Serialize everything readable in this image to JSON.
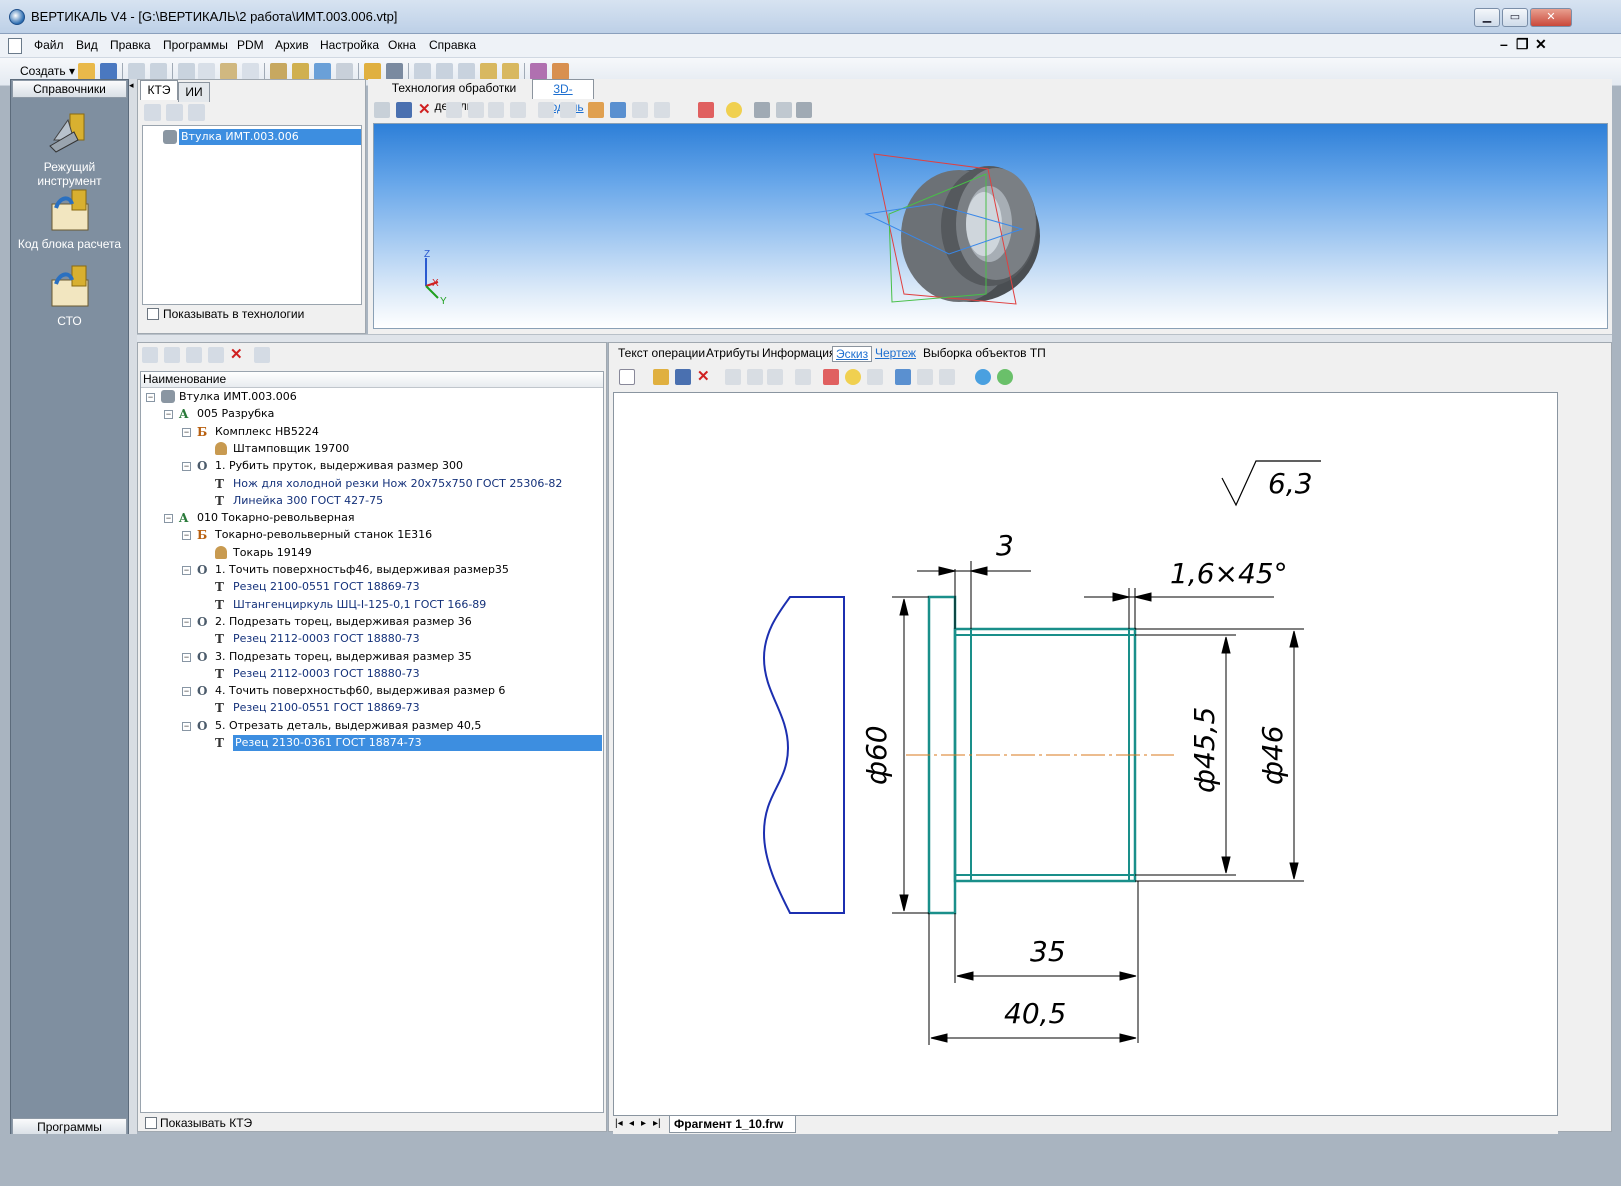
{
  "window": {
    "title": "ВЕРТИКАЛЬ V4 - [G:\\ВЕРТИКАЛЬ\\2 работа\\ИМТ.003.006.vtp]",
    "min_label": "▁",
    "max_label": "▭",
    "close_label": "✕"
  },
  "menu": {
    "items": [
      "Файл",
      "Вид",
      "Правка",
      "Программы",
      "PDM",
      "Архив",
      "Настройка",
      "Окна",
      "Справка"
    ],
    "mdi_min": "–",
    "mdi_restore": "❐",
    "mdi_close": "✕"
  },
  "toolbar": {
    "create_label": "Создать"
  },
  "left_panel": {
    "header": "Справочники",
    "items": [
      "Режущий инструмент",
      "Код блока расчета",
      "СТО"
    ],
    "footer": "Программы"
  },
  "kte": {
    "tabs": [
      "КТЭ",
      "ИИ"
    ],
    "tree_root": "Втулка  ИМТ.003.006",
    "checkbox_label": "Показывать в технологии"
  },
  "viewer": {
    "tabs": [
      "Технология обработки детали",
      "3D-модель"
    ],
    "axis_z": "Z",
    "axis_x": "X",
    "axis_y": "Y"
  },
  "tree": {
    "header": "Наименование",
    "nodes": [
      {
        "label": "Втулка  ИМТ.003.006",
        "icon": "part-icon",
        "level": 0,
        "type": "part",
        "exp": "-"
      },
      {
        "label": "005  Разрубка",
        "icon": "A",
        "level": 1,
        "type": "op",
        "exp": "-"
      },
      {
        "label": "Комплекс  НВ5224",
        "icon": "Б",
        "level": 2,
        "type": "equip",
        "exp": "-"
      },
      {
        "label": "Штамповщик 19700",
        "icon": "worker-icon",
        "level": 3,
        "type": "worker",
        "exp": ""
      },
      {
        "label": "1. Рубить пруток, выдерживая размер 300",
        "icon": "O",
        "level": 2,
        "type": "step",
        "exp": "-"
      },
      {
        "label": "Нож для холодной резки Нож   20х75х750         ГОСТ 25306-82",
        "icon": "T",
        "level": 3,
        "type": "tool",
        "exp": ""
      },
      {
        "label": "Линейка 300  ГОСТ 427-75",
        "icon": "T",
        "level": 3,
        "type": "tool",
        "exp": ""
      },
      {
        "label": "010  Токарно-револьверная",
        "icon": "A",
        "level": 1,
        "type": "op",
        "exp": "-"
      },
      {
        "label": "Токарно-револьверный станок 1Е316",
        "icon": "Б",
        "level": 2,
        "type": "equip",
        "exp": "-"
      },
      {
        "label": "Токарь 19149",
        "icon": "worker-icon",
        "level": 3,
        "type": "worker",
        "exp": ""
      },
      {
        "label": "1. Точить поверхностьф46, выдерживая размер35",
        "icon": "O",
        "level": 2,
        "type": "step",
        "exp": "-"
      },
      {
        "label": "Резец 2100-0551  ГОСТ 18869-73",
        "icon": "T",
        "level": 3,
        "type": "tool",
        "exp": ""
      },
      {
        "label": "Штангенциркуль ШЦ-I-125-0,1  ГОСТ 166-89",
        "icon": "T",
        "level": 3,
        "type": "tool",
        "exp": ""
      },
      {
        "label": "2. Подрезать торец, выдерживая размер 36",
        "icon": "O",
        "level": 2,
        "type": "step",
        "exp": "-"
      },
      {
        "label": "Резец 2112-0003  ГОСТ 18880-73",
        "icon": "T",
        "level": 3,
        "type": "tool",
        "exp": ""
      },
      {
        "label": "3. Подрезать торец, выдерживая размер 35",
        "icon": "O",
        "level": 2,
        "type": "step",
        "exp": "-"
      },
      {
        "label": "Резец 2112-0003  ГОСТ 18880-73",
        "icon": "T",
        "level": 3,
        "type": "tool",
        "exp": ""
      },
      {
        "label": "4. Точить поверхностьф60, выдерживая размер 6",
        "icon": "O",
        "level": 2,
        "type": "step",
        "exp": "-"
      },
      {
        "label": "Резец 2100-0551  ГОСТ 18869-73",
        "icon": "T",
        "level": 3,
        "type": "tool",
        "exp": ""
      },
      {
        "label": "5. Отрезать деталь, выдерживая размер 40,5",
        "icon": "O",
        "level": 2,
        "type": "step",
        "exp": "-"
      },
      {
        "label": "Резец 2130-0361  ГОСТ 18874-73",
        "icon": "T",
        "level": 3,
        "type": "tool",
        "exp": "",
        "selected": true
      }
    ],
    "checkbox_label": "Показывать КТЭ"
  },
  "right": {
    "tabs": [
      "Текст операции",
      "Атрибуты",
      "Информация",
      "Эскиз",
      "Чертеж",
      "Выборка объектов ТП"
    ],
    "fragment_tab": "Фрагмент 1_10.frw"
  },
  "drawing": {
    "roughness": "6,3",
    "dim_3": "3",
    "chamfer": "1,6×45°",
    "dia_60": "ф60",
    "dia_455": "ф45,5",
    "dia_46": "ф46",
    "len_35": "35",
    "len_405": "40,5"
  },
  "colors": {
    "accent": "#3d8ee0",
    "part_outline": "#1a8f8a",
    "blank_outline": "#1c2fb0",
    "axis": "#d87a1e",
    "tool_text": "#14317a"
  }
}
